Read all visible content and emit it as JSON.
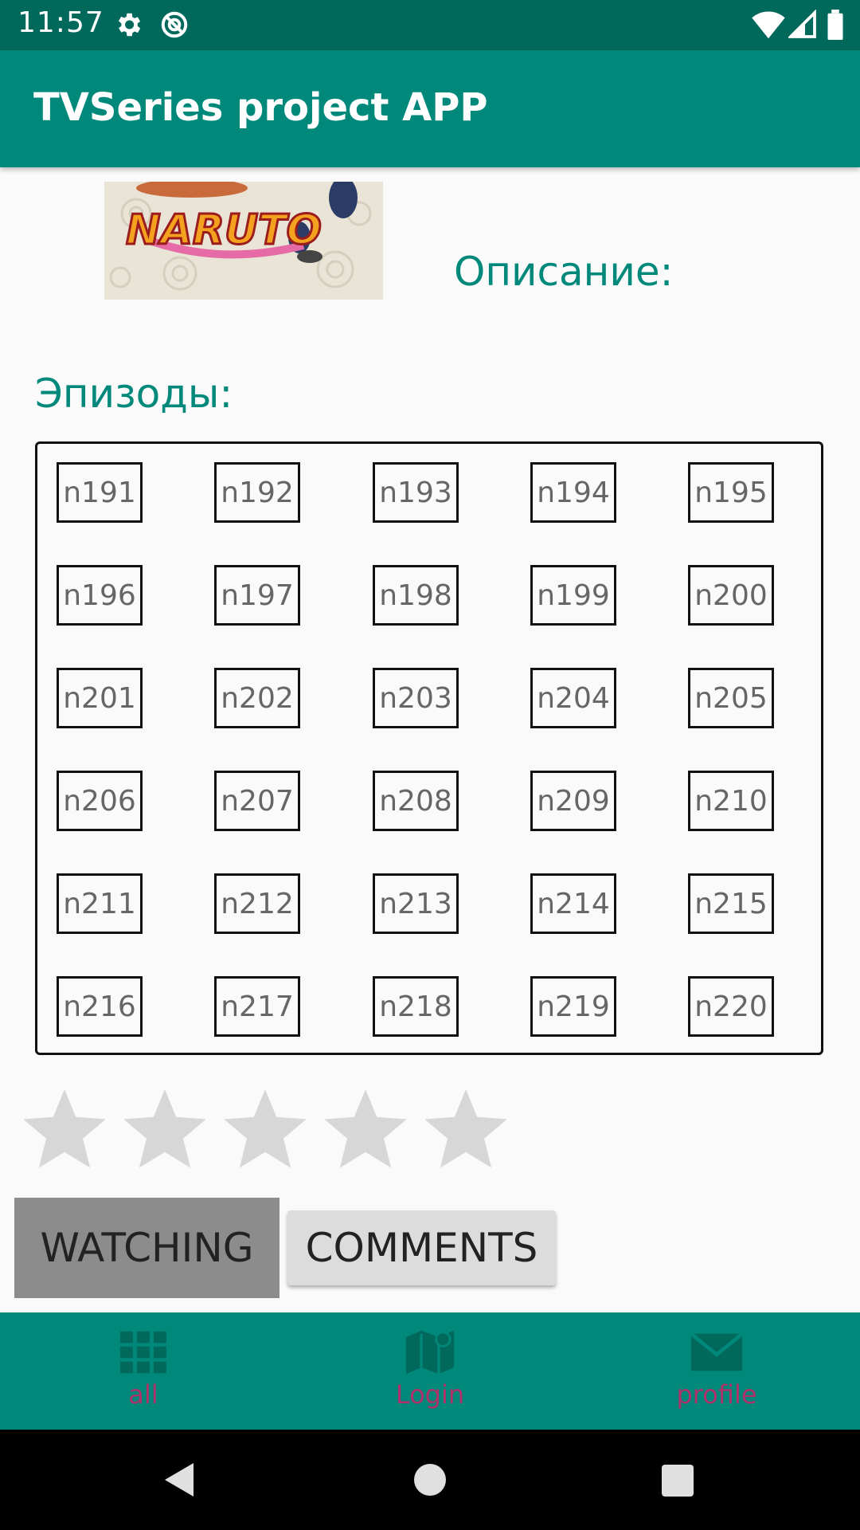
{
  "status_bar": {
    "time": "11:57"
  },
  "app_bar": {
    "title": "TVSeries project APP"
  },
  "poster": {
    "logo_text": "NARUTO"
  },
  "description": {
    "label": "Описание:"
  },
  "episodes": {
    "label": "Эпизоды:",
    "items": [
      "n191",
      "n192",
      "n193",
      "n194",
      "n195",
      "n196",
      "n197",
      "n198",
      "n199",
      "n200",
      "n201",
      "n202",
      "n203",
      "n204",
      "n205",
      "n206",
      "n207",
      "n208",
      "n209",
      "n210",
      "n211",
      "n212",
      "n213",
      "n214",
      "n215",
      "n216",
      "n217",
      "n218",
      "n219",
      "n220"
    ]
  },
  "rating": {
    "value": 0,
    "max": 5
  },
  "buttons": {
    "watching": "WATCHING",
    "comments": "COMMENTS"
  },
  "bottom_nav": [
    {
      "label": "all",
      "icon": "grid-icon"
    },
    {
      "label": "Login",
      "icon": "map-icon"
    },
    {
      "label": "profile",
      "icon": "mail-icon"
    }
  ],
  "colors": {
    "primary": "#00897b",
    "primary_dark": "#00695c",
    "accent": "#b0306a"
  }
}
